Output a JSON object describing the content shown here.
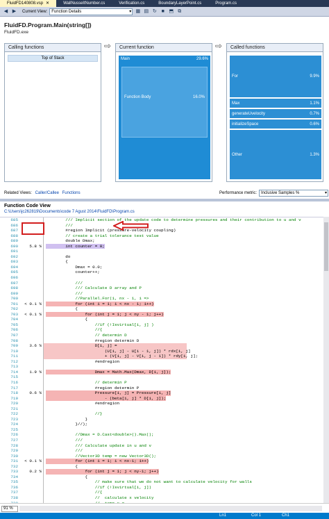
{
  "tabs": [
    {
      "label": "FluidFD140808.vsp",
      "active": true
    },
    {
      "label": "WallNusseltNumber.cs",
      "active": false
    },
    {
      "label": "Verification.cs",
      "active": false
    },
    {
      "label": "BoundaryLayerPoint.cs",
      "active": false
    },
    {
      "label": "Program.cs",
      "active": false
    }
  ],
  "toolbar": {
    "current_view_label": "Current View:",
    "current_view_value": "Function Details"
  },
  "function_details": {
    "method_name": "FluidFD.Program.Main(string[])",
    "exe_name": "FluidFD.exe",
    "calling_header": "Calling functions",
    "current_header": "Current function",
    "called_header": "Called functions",
    "calling_items": [
      {
        "label": "Top of Stack"
      }
    ],
    "current_main": {
      "label": "Main",
      "value": "29.6%"
    },
    "current_body": {
      "label": "Function Body",
      "value": "16.0%"
    },
    "called_items": [
      {
        "label": "For",
        "value": "9.9%"
      },
      {
        "label": "Max",
        "value": "1.1%"
      },
      {
        "label": "generateUvelocity",
        "value": "0.7%"
      },
      {
        "label": "initializeSpace",
        "value": "0.6%"
      },
      {
        "label": "Other",
        "value": "1.3%"
      }
    ],
    "related_views_label": "Related Views:",
    "related_links": [
      "Caller/Callee",
      "Functions"
    ],
    "metric_label": "Performance metric:",
    "metric_value": "Inclusive Samples %"
  },
  "code_view": {
    "title": "Function Code View",
    "path": "C:\\Users\\jc262819\\Documents\\code 7 Agust 2014\\FluidFD\\Program.cs",
    "lines": [
      {
        "n": "685",
        "m": "",
        "t": "        /// Implicit section of the update code to determine pressures and their contribution to u and v",
        "c": "cm"
      },
      {
        "n": "686",
        "m": "",
        "t": "        ///",
        "c": "cm"
      },
      {
        "n": "687",
        "m": "",
        "t": "        #region Implicit (pressure-velocity coupling)",
        "c": ""
      },
      {
        "n": "688",
        "m": "",
        "t": "        // create a trial tolerance test value",
        "c": "cm"
      },
      {
        "n": "689",
        "m": "",
        "t": "        double Dmax;",
        "c": ""
      },
      {
        "n": "690",
        "m": "5.8 %",
        "t": "        int counter = 0;",
        "c": "sel"
      },
      {
        "n": "691",
        "m": "",
        "t": "",
        "c": ""
      },
      {
        "n": "692",
        "m": "",
        "t": "        do",
        "c": ""
      },
      {
        "n": "693",
        "m": "",
        "t": "        {",
        "c": ""
      },
      {
        "n": "694",
        "m": "",
        "t": "            Dmax = 0.0;",
        "c": ""
      },
      {
        "n": "695",
        "m": "",
        "t": "            counter++;",
        "c": ""
      },
      {
        "n": "696",
        "m": "",
        "t": "",
        "c": ""
      },
      {
        "n": "697",
        "m": "",
        "t": "            ///",
        "c": "cm"
      },
      {
        "n": "698",
        "m": "",
        "t": "            /// Calculate D array and P",
        "c": "cm"
      },
      {
        "n": "699",
        "m": "",
        "t": "            ///",
        "c": "cm"
      },
      {
        "n": "700",
        "m": "",
        "t": "            //Parallel.For(1, nx - 1, i =>",
        "c": "cm"
      },
      {
        "n": "701",
        "m": "< 0.1 %",
        "t": "            for (int i = 1; i < nx - 1; i++)",
        "c": "hlpart"
      },
      {
        "n": "702",
        "m": "",
        "t": "            {",
        "c": ""
      },
      {
        "n": "703",
        "m": "< 0.1 %",
        "t": "                for (int j = 1; j < ny - 1; j++)",
        "c": "hlpart"
      },
      {
        "n": "704",
        "m": "",
        "t": "                {",
        "c": ""
      },
      {
        "n": "705",
        "m": "",
        "t": "                    //if (!Isvirtual[i, j] )",
        "c": "cm"
      },
      {
        "n": "706",
        "m": "",
        "t": "                    //{",
        "c": "cm"
      },
      {
        "n": "707",
        "m": "",
        "t": "                    // determin D",
        "c": "cm"
      },
      {
        "n": "708",
        "m": "",
        "t": "                    #region determin D",
        "c": ""
      },
      {
        "n": "709",
        "m": "3.6 %",
        "t": "                    D[i, j] =",
        "c": "hlrow"
      },
      {
        "n": "710",
        "m": "",
        "t": "                        (U[i, j] - U[i - 1, j]) * rdx[i, j]",
        "c": "hlrow"
      },
      {
        "n": "711",
        "m": "",
        "t": "                        + (V[i, j] - V[i, j - 1]) * rdy[i, j];",
        "c": "hlrow"
      },
      {
        "n": "712",
        "m": "",
        "t": "                    #endregion",
        "c": ""
      },
      {
        "n": "713",
        "m": "",
        "t": "",
        "c": ""
      },
      {
        "n": "714",
        "m": "1.9 %",
        "t": "                    Dmax = Math.Max(Dmax, D[i, j]);",
        "c": "hlpart"
      },
      {
        "n": "715",
        "m": "",
        "t": "",
        "c": ""
      },
      {
        "n": "716",
        "m": "",
        "t": "                    // determin P",
        "c": "cm"
      },
      {
        "n": "717",
        "m": "",
        "t": "                    #region determin P",
        "c": ""
      },
      {
        "n": "718",
        "m": "0.6 %",
        "t": "                    Pressure[i, j] = Pressure[i, j]",
        "c": "hlpart"
      },
      {
        "n": "719",
        "m": "",
        "t": "                        - (beta[i, j] * D[i, j]);",
        "c": "hlpart"
      },
      {
        "n": "720",
        "m": "",
        "t": "                    #endregion",
        "c": ""
      },
      {
        "n": "721",
        "m": "",
        "t": "",
        "c": ""
      },
      {
        "n": "722",
        "m": "",
        "t": "                    //}",
        "c": "cm"
      },
      {
        "n": "723",
        "m": "",
        "t": "                }",
        "c": ""
      },
      {
        "n": "724",
        "m": "",
        "t": "            }//);",
        "c": ""
      },
      {
        "n": "725",
        "m": "",
        "t": "",
        "c": ""
      },
      {
        "n": "726",
        "m": "",
        "t": "            //Dmax = D.Cast<double>().Max();",
        "c": "cm"
      },
      {
        "n": "727",
        "m": "",
        "t": "            ///",
        "c": "cm"
      },
      {
        "n": "728",
        "m": "",
        "t": "            /// Calculate update in u and v",
        "c": "cm"
      },
      {
        "n": "729",
        "m": "",
        "t": "            ///",
        "c": "cm"
      },
      {
        "n": "730",
        "m": "",
        "t": "            //Vector3D temp = new Vector3D();",
        "c": "cm"
      },
      {
        "n": "731",
        "m": "< 0.1 %",
        "t": "            for (int i = 1; i < nx-1; i++)",
        "c": "hlpart"
      },
      {
        "n": "732",
        "m": "",
        "t": "            {",
        "c": ""
      },
      {
        "n": "733",
        "m": "0.2 %",
        "t": "                for (int j = 1; j < ny-1; j++)",
        "c": "hlpart"
      },
      {
        "n": "734",
        "m": "",
        "t": "                {",
        "c": ""
      },
      {
        "n": "735",
        "m": "",
        "t": "                    // make sure that we do not want to calculate velocity for walls",
        "c": "cm"
      },
      {
        "n": "736",
        "m": "",
        "t": "                    //if (!Isvirtual[i, j])",
        "c": "cm"
      },
      {
        "n": "737",
        "m": "",
        "t": "                    //{",
        "c": "cm"
      },
      {
        "n": "738",
        "m": "",
        "t": "                    //  calculate x velocity",
        "c": "cm"
      },
      {
        "n": "739",
        "m": "",
        "t": "                    //  temp.x = ...",
        "c": "cm"
      }
    ]
  },
  "status": {
    "zoom": "91 %",
    "ln": "Ln1",
    "col": "Col 1",
    "ch": "Ch1"
  },
  "colors": {
    "tabbar": "#293955",
    "accent": "#007acc",
    "annotation_red": "#d21e1e",
    "hot_line": "#f7c6c6"
  }
}
